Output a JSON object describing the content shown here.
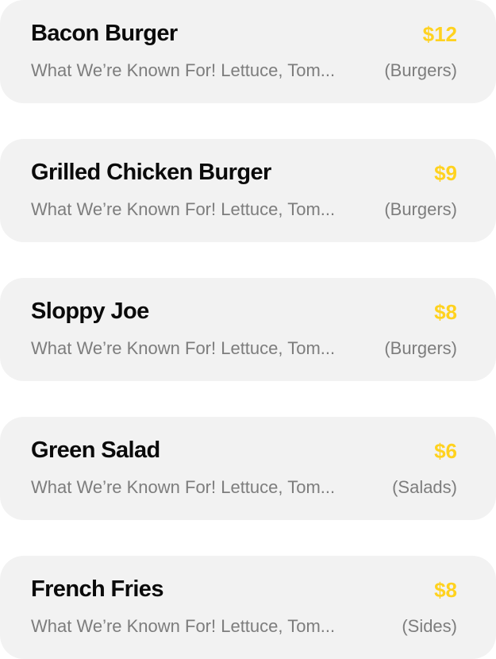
{
  "colors": {
    "card_background": "#f2f2f2",
    "name_text": "#0a0a0a",
    "price_accent": "#ffd21f",
    "secondary_text": "#7d7d7d"
  },
  "menu": {
    "items": [
      {
        "name": "Bacon Burger",
        "price": "$12",
        "description": "What We’re Known For! Lettuce, Tom...",
        "category": "(Burgers)"
      },
      {
        "name": "Grilled Chicken Burger",
        "price": "$9",
        "description": "What We’re Known For! Lettuce, Tom...",
        "category": "(Burgers)"
      },
      {
        "name": "Sloppy Joe",
        "price": "$8",
        "description": "What We’re Known For! Lettuce, Tom...",
        "category": "(Burgers)"
      },
      {
        "name": "Green Salad",
        "price": "$6",
        "description": "What We’re Known For! Lettuce, Tom...",
        "category": "(Salads)"
      },
      {
        "name": "French Fries",
        "price": "$8",
        "description": "What We’re Known For! Lettuce, Tom...",
        "category": "(Sides)"
      }
    ]
  }
}
